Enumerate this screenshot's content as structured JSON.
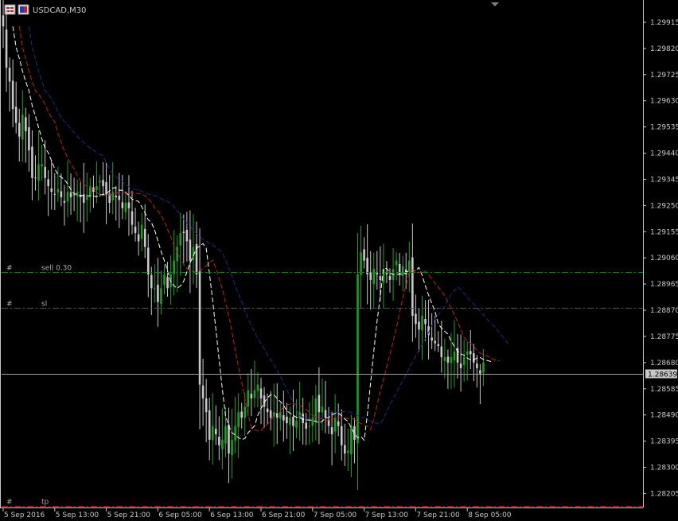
{
  "window": {
    "title": "USDCAD,M30",
    "icons": [
      "chart-window-icon",
      "trading-flag-icon"
    ]
  },
  "colors": {
    "background": "#000000",
    "frame": "#c8c8c8",
    "bull": "#1aa31a",
    "bear": "#c8c8c8",
    "ma_fast": "#ffffff",
    "ma_mid": "#c81e1e",
    "ma_slow": "#1e2a8c",
    "order_line": "#1a7a1a",
    "sl_line": "#c81e1e",
    "tp_line": "#c81e1e",
    "price_line": "#a0a0a0",
    "price_label_bg": "#c8c8c8"
  },
  "orders": {
    "sell": {
      "price": 1.2901,
      "label": "sell 0.30",
      "ticket": "#"
    },
    "sl": {
      "price": 1.2888,
      "label": "sl",
      "ticket": "#"
    },
    "tp": {
      "price": 1.2816,
      "label": "tp",
      "ticket": "#"
    }
  },
  "current_price": {
    "value": 1.28639,
    "label": "1.28639"
  },
  "chart_data": {
    "type": "candlestick",
    "symbol": "USDCAD",
    "timeframe": "M30",
    "ylim": [
      1.2816,
      1.2999
    ],
    "yticks": [
      "1.29915",
      "1.29820",
      "1.29725",
      "1.29630",
      "1.29535",
      "1.29440",
      "1.29345",
      "1.29250",
      "1.29155",
      "1.29060",
      "1.28965",
      "1.28870",
      "1.28775",
      "1.28680",
      "1.28585",
      "1.28490",
      "1.28395",
      "1.28300",
      "1.28205"
    ],
    "xticks": [
      {
        "label": "5 Sep 2016",
        "bar": 0
      },
      {
        "label": "5 Sep 13:00",
        "bar": 16
      },
      {
        "label": "5 Sep 21:00",
        "bar": 32
      },
      {
        "label": "6 Sep 05:00",
        "bar": 48
      },
      {
        "label": "6 Sep 13:00",
        "bar": 64
      },
      {
        "label": "6 Sep 21:00",
        "bar": 80
      },
      {
        "label": "7 Sep 05:00",
        "bar": 96
      },
      {
        "label": "7 Sep 13:00",
        "bar": 112
      },
      {
        "label": "7 Sep 21:00",
        "bar": 128
      },
      {
        "label": "8 Sep 05:00",
        "bar": 144
      }
    ],
    "close": [
      1.299,
      1.2975,
      1.297,
      1.296,
      1.2955,
      1.295,
      1.2958,
      1.2952,
      1.2945,
      1.2935,
      1.2935,
      1.294,
      1.294,
      1.2935,
      1.2932,
      1.293,
      1.2929,
      1.2931,
      1.2928,
      1.2926,
      1.293,
      1.2928,
      1.2929,
      1.293,
      1.2928,
      1.2926,
      1.2928,
      1.2932,
      1.293,
      1.2932,
      1.2934,
      1.2932,
      1.2929,
      1.2926,
      1.293,
      1.2928,
      1.2927,
      1.2924,
      1.2926,
      1.2924,
      1.2918,
      1.2915,
      1.2912,
      1.2918,
      1.291,
      1.29,
      1.2895,
      1.2895,
      1.289,
      1.2895,
      1.29,
      1.2895,
      1.29,
      1.2905,
      1.291,
      1.2915,
      1.2915,
      1.2912,
      1.2905,
      1.291,
      1.29,
      1.286,
      1.2855,
      1.285,
      1.284,
      1.2845,
      1.2842,
      1.2838,
      1.284,
      1.2845,
      1.2835,
      1.284,
      1.2845,
      1.285,
      1.2848,
      1.2852,
      1.2858,
      1.2855,
      1.2858,
      1.286,
      1.2855,
      1.2852,
      1.285,
      1.2848,
      1.285,
      1.2848,
      1.285,
      1.2847,
      1.2846,
      1.2848,
      1.2845,
      1.2847,
      1.285,
      1.2846,
      1.2844,
      1.2845,
      1.2848,
      1.2855,
      1.285,
      1.2852,
      1.2848,
      1.2845,
      1.2842,
      1.2848,
      1.2845,
      1.2838,
      1.2835,
      1.2836,
      1.2845,
      1.284,
      1.29,
      1.2908,
      1.2905,
      1.29,
      1.2898,
      1.2902,
      1.29,
      1.2898,
      1.2902,
      1.29,
      1.2898,
      1.2902,
      1.2905,
      1.29,
      1.2903,
      1.29,
      1.2905,
      1.2885,
      1.2882,
      1.288,
      1.2885,
      1.2882,
      1.2878,
      1.2876,
      1.2875,
      1.2874,
      1.287,
      1.287,
      1.2868,
      1.287,
      1.2872,
      1.2868,
      1.2866,
      1.287,
      1.2872,
      1.2871,
      1.2868,
      1.2866,
      1.2864,
      1.2868
    ],
    "series": [
      {
        "name": "MA fast"
      },
      {
        "name": "MA mid"
      },
      {
        "name": "MA slow"
      }
    ],
    "grid": false
  }
}
